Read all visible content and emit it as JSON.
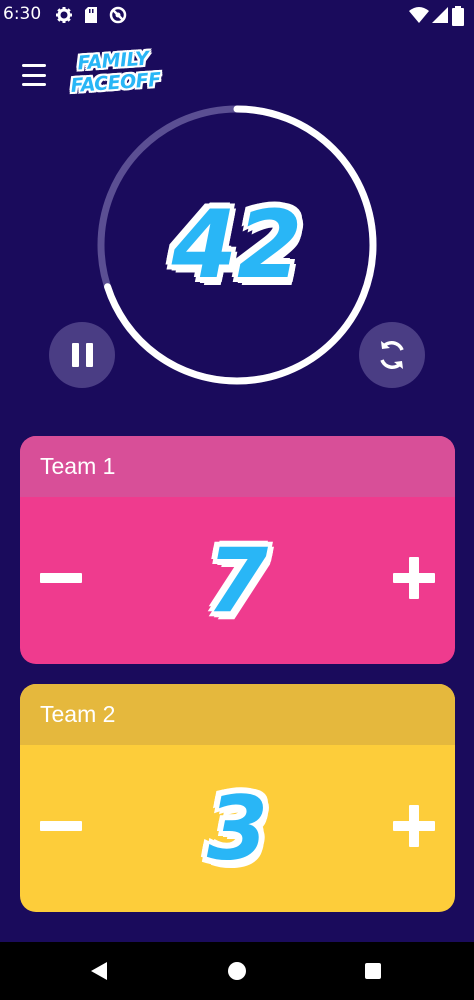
{
  "status_bar": {
    "time": "6:30",
    "icons": [
      "gear-icon",
      "sd-card-icon",
      "no-disturb-icon",
      "wifi-icon",
      "signal-icon",
      "battery-icon"
    ]
  },
  "header": {
    "menu_icon": "hamburger-menu-icon",
    "logo_line1": "FAMILY",
    "logo_line2": "FACEOFF"
  },
  "timer": {
    "value": "42",
    "progress": 0.7,
    "pause_icon": "pause-icon",
    "reset_icon": "refresh-icon"
  },
  "teams": [
    {
      "name": "Team 1",
      "score": "7",
      "minus_icon": "minus-icon",
      "plus_icon": "plus-icon",
      "color": "#ef3b8e",
      "header_color": "#d84f98"
    },
    {
      "name": "Team 2",
      "score": "3",
      "minus_icon": "minus-icon",
      "plus_icon": "plus-icon",
      "color": "#fdcd3a",
      "header_color": "#e5b83d"
    }
  ],
  "nav": {
    "back_icon": "back-triangle-icon",
    "home_icon": "home-circle-icon",
    "recents_icon": "recents-square-icon"
  },
  "colors": {
    "background": "#1a0b5c",
    "accent": "#29b6f6",
    "ring": "#ffffff",
    "ring_track": "#5b4f93"
  }
}
